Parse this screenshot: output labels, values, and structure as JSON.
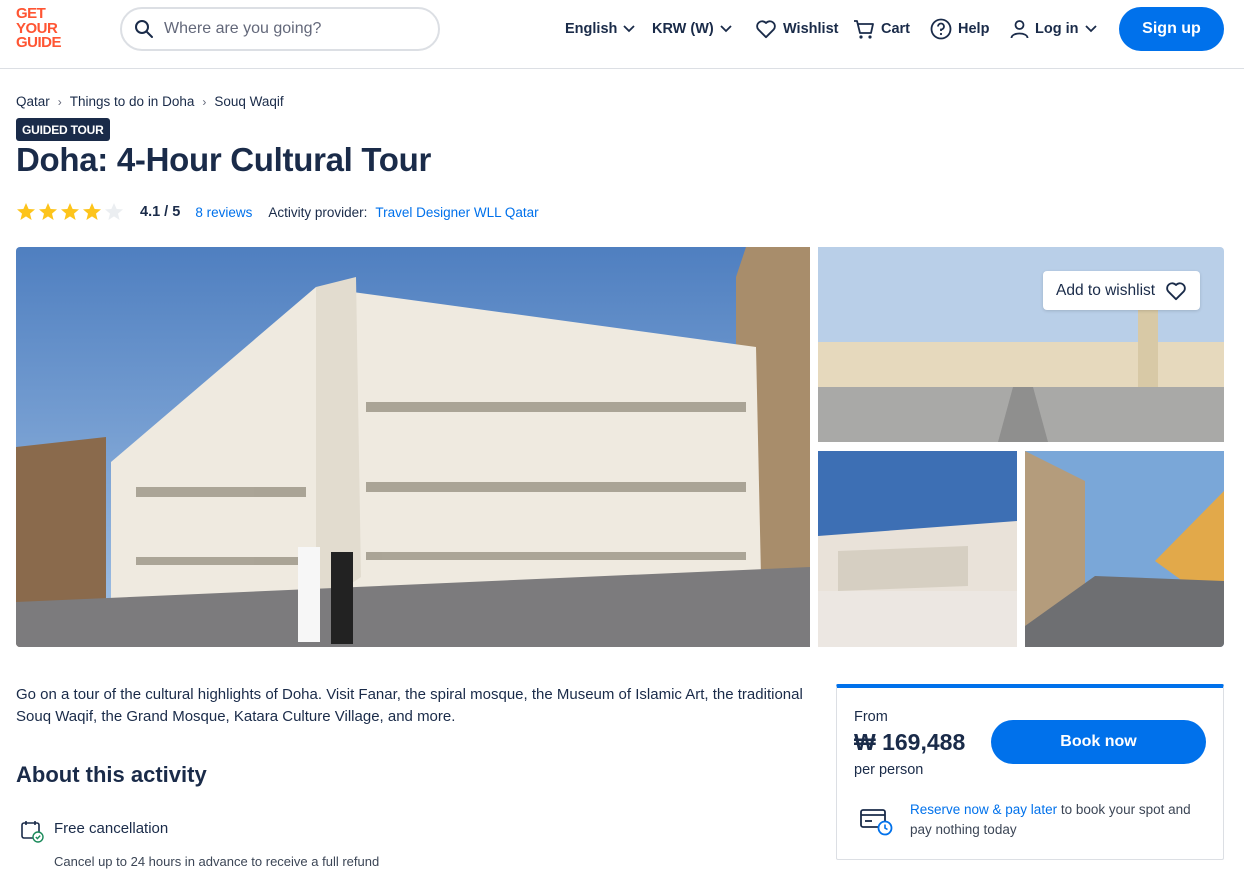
{
  "header": {
    "logo_lines": [
      "GET",
      "YOUR",
      "GUIDE"
    ],
    "search_placeholder": "Where are you going?",
    "language": "English",
    "currency": "KRW (W)",
    "wishlist": "Wishlist",
    "cart": "Cart",
    "help": "Help",
    "login": "Log in",
    "signup": "Sign up"
  },
  "breadcrumb": [
    "Qatar",
    "Things to do in Doha",
    "Souq Waqif"
  ],
  "badge": "GUIDED TOUR",
  "title": "Doha: 4-Hour Cultural Tour",
  "rating": {
    "stars": 4.1,
    "value": "4.1 / 5",
    "reviews": "8 reviews",
    "provider_label": "Activity provider:",
    "provider": "Travel Designer WLL Qatar"
  },
  "gallery": {
    "add_to_wishlist": "Add to wishlist"
  },
  "description": "Go on a tour of the cultural highlights of Doha. Visit Fanar, the spiral mosque, the Museum of Islamic Art, the traditional Souq Waqif, the Grand Mosque, Katara Culture Village, and more.",
  "about": {
    "heading": "About this activity",
    "features": [
      {
        "title": "Free cancellation",
        "desc": "Cancel up to 24 hours in advance to receive a full refund"
      }
    ]
  },
  "booking": {
    "from": "From",
    "price": "₩ 169,488",
    "per": "per person",
    "book_now": "Book now",
    "reserve_link": "Reserve now & pay later",
    "reserve_rest": " to book your spot and pay nothing today"
  },
  "colors": {
    "brand": "#ff5533",
    "primary": "#0071eb",
    "text": "#1a2b49",
    "star": "#fdc41b"
  }
}
